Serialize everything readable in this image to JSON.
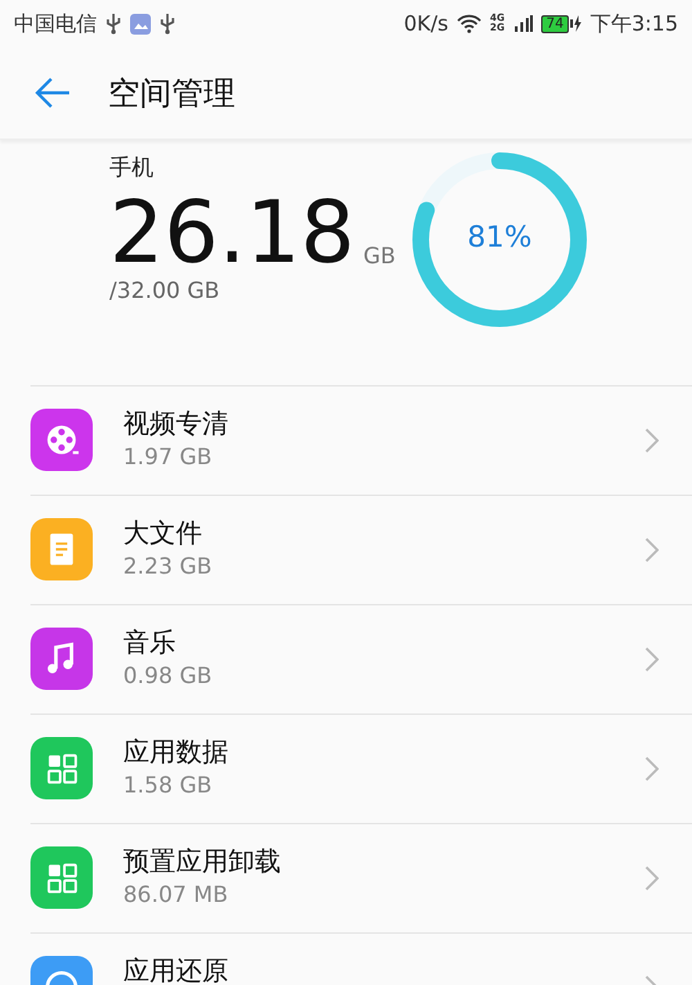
{
  "status_bar": {
    "carrier": "中国电信",
    "speed": "0K/s",
    "network_top": "4G",
    "network_bottom": "2G",
    "battery": "74",
    "time": "下午3:15"
  },
  "header": {
    "title": "空间管理"
  },
  "storage": {
    "device": "手机",
    "used": "26.18",
    "unit": "GB",
    "total": "/32.00 GB",
    "percent": "81%"
  },
  "items": [
    {
      "kind": "video",
      "title": "视频专清",
      "size": "1.97 GB",
      "color": "#cc35ec"
    },
    {
      "kind": "file",
      "title": "大文件",
      "size": "2.23 GB",
      "color": "#fbb022"
    },
    {
      "kind": "music",
      "title": "音乐",
      "size": "0.98 GB",
      "color": "#c636e8"
    },
    {
      "kind": "apps",
      "title": "应用数据",
      "size": "1.58 GB",
      "color": "#1fc75c"
    },
    {
      "kind": "apps",
      "title": "预置应用卸载",
      "size": "86.07 MB",
      "color": "#1fc75c"
    },
    {
      "kind": "restore",
      "title": "应用还原",
      "color": "#3d9cf5"
    }
  ]
}
